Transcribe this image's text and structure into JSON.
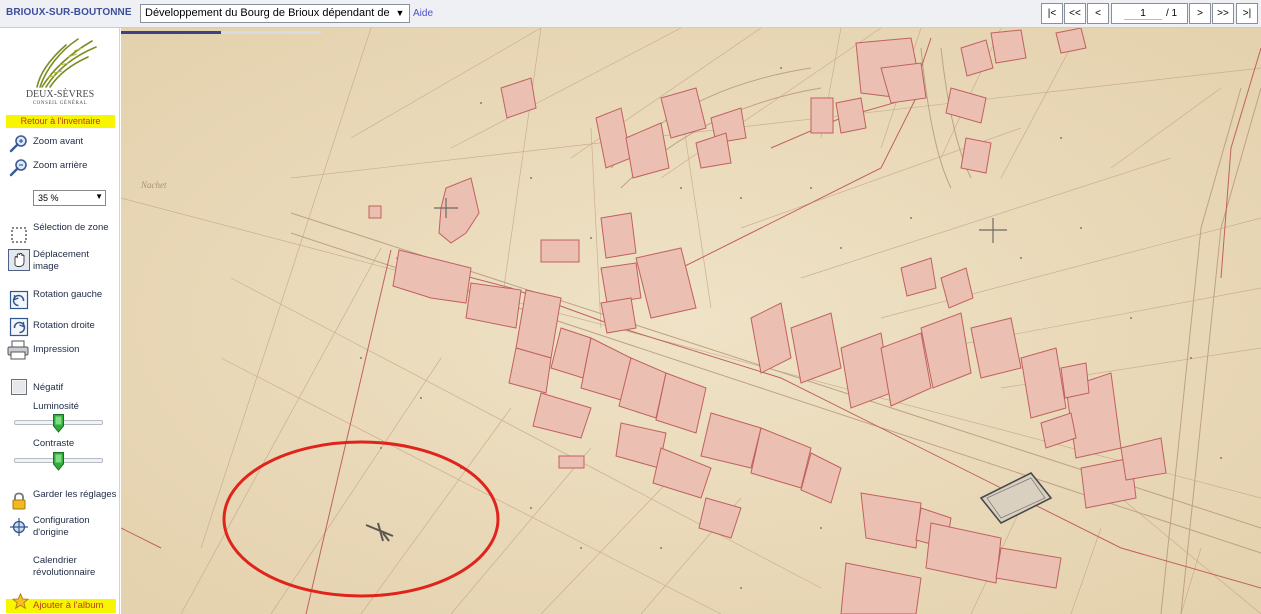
{
  "header": {
    "site_title": "BRIOUX-SUR-BOUTONNE",
    "document_selected": "Développement du Bourg de Brioux dépendant de",
    "help_label": "Aide"
  },
  "pager": {
    "first_label": "|<",
    "prev_fast_label": "<<",
    "prev_label": "<",
    "current_page": "1",
    "total_label": "/ 1",
    "next_label": ">",
    "next_fast_label": ">>",
    "last_label": ">|"
  },
  "sidebar": {
    "logo_name": "DEUX-SÈVRES",
    "logo_sub": "CONSEIL GÉNÉRAL",
    "back_label": "Retour à l'inventaire",
    "zoom_in_label": "Zoom avant",
    "zoom_out_label": "Zoom arrière",
    "zoom_level": "35 %",
    "select_zone_label": "Sélection de zone",
    "pan_label": "Déplacement image",
    "rotate_left_label": "Rotation gauche",
    "rotate_right_label": "Rotation droite",
    "print_label": "Impression",
    "negative_label": "Négatif",
    "negative_checked": false,
    "brightness_label": "Luminosité",
    "brightness_value": 0.5,
    "contrast_label": "Contraste",
    "contrast_value": 0.5,
    "keep_settings_label": "Garder les réglages",
    "reset_label": "Configuration d'origine",
    "calendar_label": "Calendrier révolutionnaire",
    "album_label": "Ajouter à l'album"
  },
  "viewer": {
    "load_progress": 0.5,
    "map_annotation": "Nachet"
  },
  "colors": {
    "accent": "#3d4e9a",
    "link": "#4a55c8",
    "highlight": "#f7f500",
    "highlight_text": "#c0391b",
    "paper": "#ecdcbc",
    "ink_red": "#c0615f",
    "building_fill": "#ebbfb2",
    "circle": "#e0241b"
  }
}
